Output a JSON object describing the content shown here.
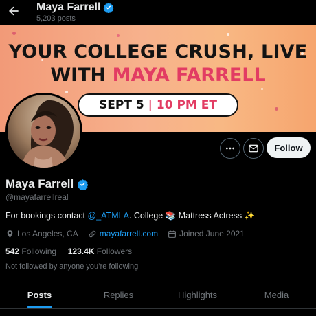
{
  "header": {
    "name": "Maya Farrell",
    "post_count": "5,203 posts",
    "back_icon": "arrow-left-icon",
    "verified_icon": "verified-badge-icon"
  },
  "banner": {
    "line1": "YOUR COLLEGE CRUSH, LIVE",
    "line2_prefix": "WITH ",
    "line2_highlight": "MAYA FARRELL",
    "date": "SEPT  5",
    "divider": "|",
    "time": "10 PM ET"
  },
  "actions": {
    "more_icon": "more-horizontal-icon",
    "message_icon": "envelope-icon",
    "follow_label": "Follow"
  },
  "profile": {
    "name": "Maya Farrell",
    "handle": "@mayafarrellreal",
    "bio_prefix": "For bookings contact ",
    "bio_mention": "@_ATMLA",
    "bio_suffix": ". College 📚 Mattress Actress ✨",
    "location": "Los Angeles, CA",
    "website": "mayafarrell.com",
    "joined": "Joined June 2021",
    "following_count": "542",
    "following_label": "Following",
    "followers_count": "123.4K",
    "followers_label": "Followers",
    "not_followed": "Not followed by anyone you’re following"
  },
  "tabs": [
    {
      "label": "Posts",
      "active": true
    },
    {
      "label": "Replies",
      "active": false
    },
    {
      "label": "Highlights",
      "active": false
    },
    {
      "label": "Media",
      "active": false
    }
  ],
  "colors": {
    "accent": "#1d9bf0",
    "banner_highlight": "#e23c63",
    "text_secondary": "#71767b"
  }
}
